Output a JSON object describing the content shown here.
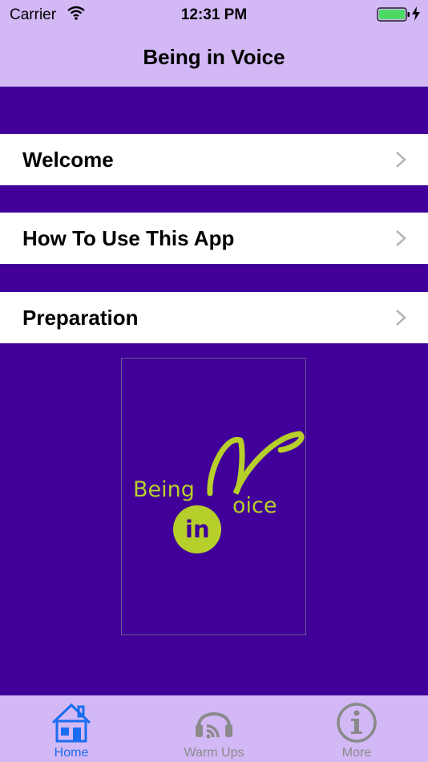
{
  "status_bar": {
    "carrier": "Carrier",
    "time": "12:31 PM"
  },
  "nav": {
    "title": "Being in Voice"
  },
  "menu": [
    {
      "label": "Welcome"
    },
    {
      "label": "How To Use This App"
    },
    {
      "label": "Preparation"
    }
  ],
  "logo": {
    "text_being": "Being",
    "text_in": "in",
    "text_oice": "oice"
  },
  "tabs": [
    {
      "label": "Home",
      "icon": "house-icon"
    },
    {
      "label": "Warm Ups",
      "icon": "headphones-icon"
    },
    {
      "label": "More",
      "icon": "info-icon"
    }
  ],
  "colors": {
    "nav_bg": "#d2b8f5",
    "page_bg": "#400099",
    "logo_accent": "#b7cf2a",
    "tab_active": "#1a6cf0",
    "tab_inactive": "#8a8a8a",
    "battery": "#4cd964"
  }
}
